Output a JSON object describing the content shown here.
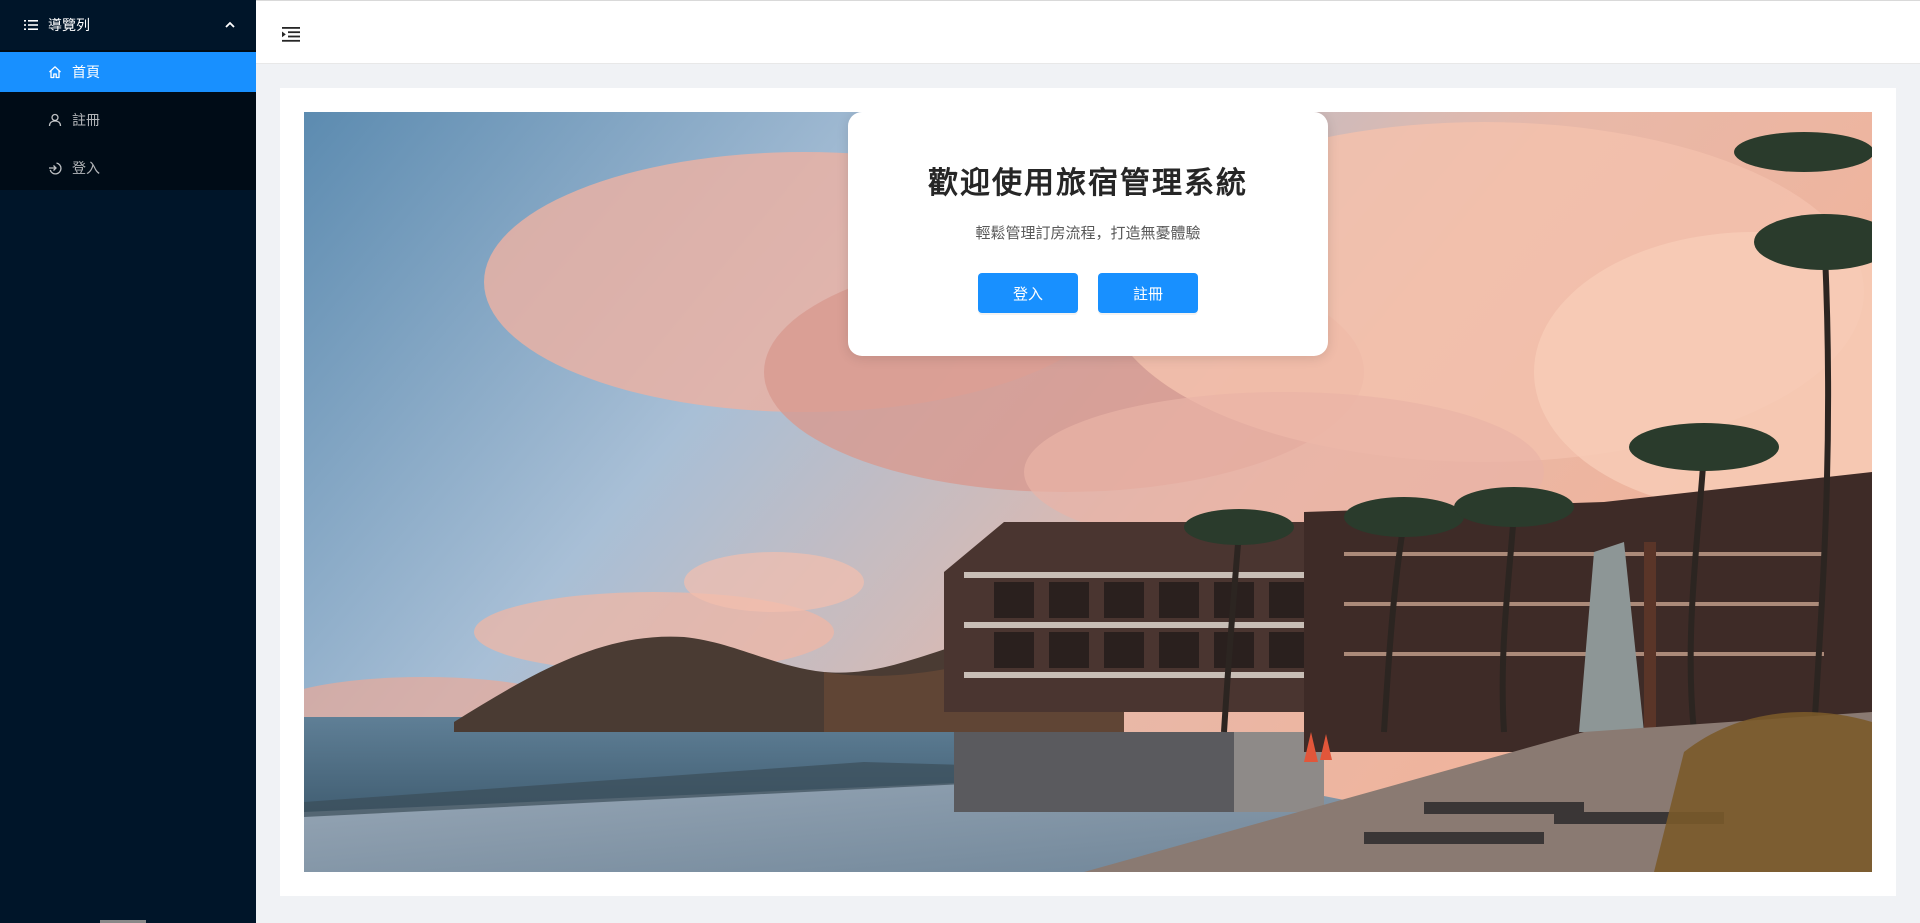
{
  "sidebar": {
    "group_label": "導覽列",
    "items": [
      {
        "label": "首頁",
        "icon": "home-icon",
        "active": true
      },
      {
        "label": "註冊",
        "icon": "user-icon",
        "active": false
      },
      {
        "label": "登入",
        "icon": "login-icon",
        "active": false
      }
    ]
  },
  "header": {
    "trigger_icon": "menu-fold-icon"
  },
  "welcome": {
    "title": "歡迎使用旅宿管理系統",
    "subtitle": "輕鬆管理訂房流程，打造無憂體驗",
    "login_label": "登入",
    "register_label": "註冊"
  },
  "colors": {
    "sidebar_bg": "#001529",
    "submenu_bg": "#000c17",
    "primary": "#1890ff"
  }
}
